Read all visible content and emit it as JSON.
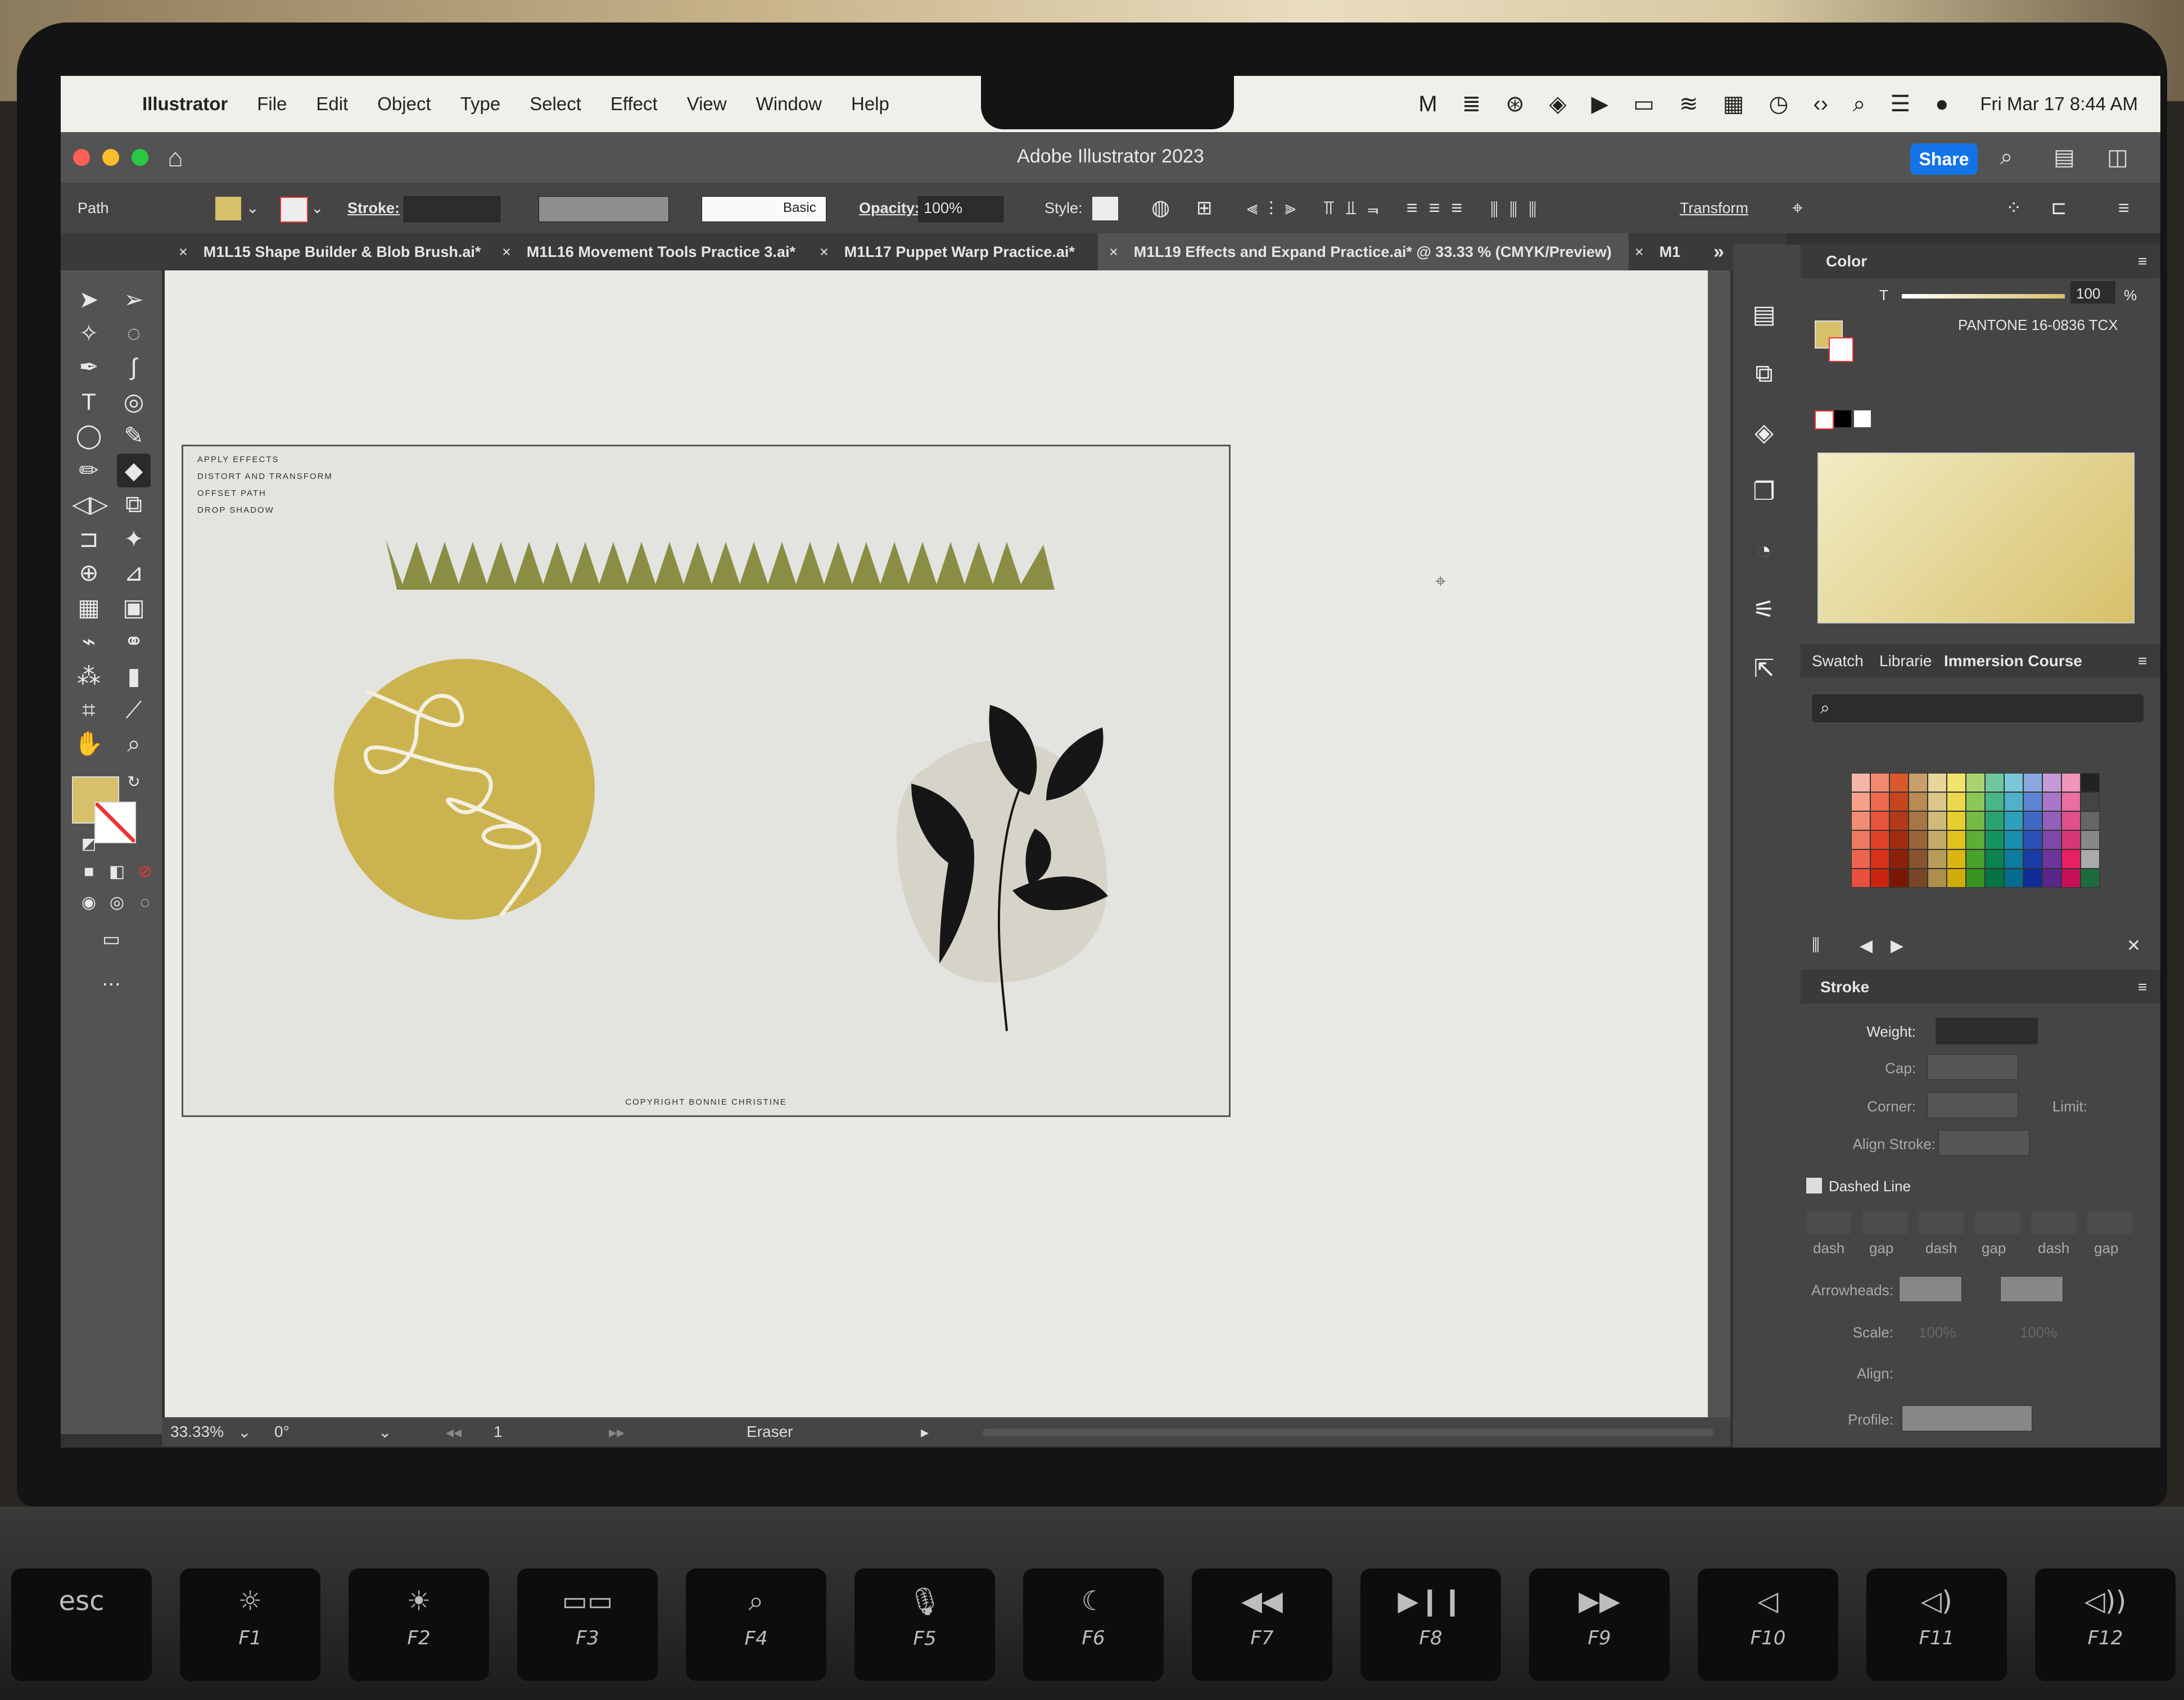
{
  "macos": {
    "app_name": "Illustrator",
    "menus": [
      "File",
      "Edit",
      "Object",
      "Type",
      "Select",
      "Effect",
      "View",
      "Window",
      "Help"
    ],
    "clock": "Fri Mar 17  8:44 AM",
    "status_icons": [
      "malwarebytes-icon",
      "stack-icon",
      "creative-cloud-icon",
      "vpn-icon",
      "media-play-icon",
      "battery-icon",
      "wifi-icon",
      "calendar-icon",
      "time-machine-icon",
      "code-icon",
      "spotlight-icon",
      "control-center-icon",
      "siri-icon"
    ]
  },
  "window": {
    "title": "Adobe Illustrator 2023",
    "share_label": "Share"
  },
  "control_bar": {
    "selection_type": "Path",
    "stroke_label": "Stroke:",
    "brush_label": "Basic",
    "opacity_label": "Opacity:",
    "opacity_value": "100%",
    "style_label": "Style:",
    "transform_label": "Transform",
    "fill_color": "#d6c06a"
  },
  "tabs": [
    {
      "label": "M1L15 Shape Builder & Blob Brush.ai*",
      "active": false
    },
    {
      "label": "M1L16 Movement Tools Practice 3.ai*",
      "active": false
    },
    {
      "label": "M1L17 Puppet Warp Practice.ai*",
      "active": false
    },
    {
      "label": "M1L19 Effects and Expand Practice.ai* @ 33.33 % (CMYK/Preview)",
      "active": true
    },
    {
      "label": "M1",
      "active": false
    }
  ],
  "artboard": {
    "notes": [
      "APPLY EFFECTS",
      "DISTORT AND TRANSFORM",
      "OFFSET PATH",
      "DROP SHADOW"
    ],
    "copyright": "COPYRIGHT BONNIE CHRISTINE",
    "colors": {
      "zigzag": "#8a8e45",
      "circle": "#cbb44f",
      "leaf": "#161616",
      "blob": "#d6d3c8"
    }
  },
  "status_bar": {
    "zoom": "33.33%",
    "rotation": "0°",
    "artboard_number": "1",
    "current_tool": "Eraser"
  },
  "color_panel": {
    "title": "Color",
    "tint_label": "T",
    "tint_value": "100",
    "percent": "%",
    "swatch_name": "PANTONE 16-0836 TCX",
    "fill_color": "#d6c06a"
  },
  "swatches_panel": {
    "tabs": [
      "Swatch",
      "Librarie",
      "Immersion Course"
    ],
    "search_placeholder": ""
  },
  "stroke_panel": {
    "title": "Stroke",
    "weight_label": "Weight:",
    "cap_label": "Cap:",
    "corner_label": "Corner:",
    "limit_label": "Limit:",
    "align_label": "Align Stroke:",
    "dashed_label": "Dashed Line",
    "dash_cols": [
      "dash",
      "gap",
      "dash",
      "gap",
      "dash",
      "gap"
    ],
    "arrowheads_label": "Arrowheads:",
    "scale_label": "Scale:",
    "scale_values": [
      "100%",
      "100%"
    ],
    "align2_label": "Align:",
    "profile_label": "Profile:"
  },
  "keyboard": {
    "keys": [
      {
        "icon": "esc",
        "label": ""
      },
      {
        "icon": "☼",
        "label": "F1"
      },
      {
        "icon": "☀",
        "label": "F2"
      },
      {
        "icon": "▭▭",
        "label": "F3"
      },
      {
        "icon": "⌕",
        "label": "F4"
      },
      {
        "icon": "🎙",
        "label": "F5"
      },
      {
        "icon": "☾",
        "label": "F6"
      },
      {
        "icon": "◀◀",
        "label": "F7"
      },
      {
        "icon": "▶❙❙",
        "label": "F8"
      },
      {
        "icon": "▶▶",
        "label": "F9"
      },
      {
        "icon": "◁",
        "label": "F10"
      },
      {
        "icon": "◁)",
        "label": "F11"
      },
      {
        "icon": "◁))",
        "label": "F12"
      }
    ]
  }
}
